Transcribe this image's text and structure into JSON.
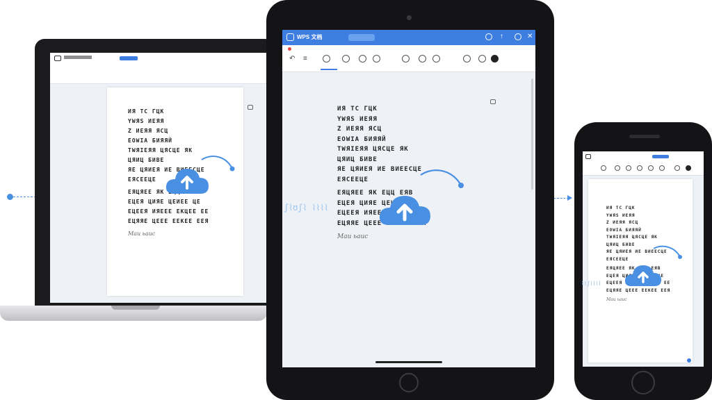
{
  "app": {
    "tablet_title": "WPS 文档",
    "laptop_title": "",
    "accent_color": "#3d7ee0"
  },
  "document": {
    "lines": [
      "ИЯ ТС ГЦК",
      "YWЯS ИЕЯЯ",
      "Z ИЕЯЯ ЯСЦ",
      "EOWIA БИЯЯЙ",
      "TWЯIЕЯЯ ЦЯСЦЕ ЯK",
      "ЦЯИЦ БИВЕ",
      "ЯЕ ЦЯИЕЯ ИЕ ВИЕЕСЦЕ",
      "ЕЯСЕЕЦЕ"
    ],
    "paragraph_lines": [
      "ЕЯЦЯЕЕ ЯК ЕЦЦ ЕЯВ",
      "ЕЦЕЯ ЦИЯЕ ЦЕИЕЕ ЦЕ",
      "ЕЦЕЕЯ ИЯЕЕЕ ЕКЦЕЕ ЕЕ",
      "ЕЦЯЯЕ ЦЕЕЕ ЕЕКЕЕ ЕЕЯ"
    ],
    "signature": "Mau ьаис"
  },
  "icons": {
    "cloud": "cloud-upload-icon",
    "sync_arc": "sync-arc-icon",
    "lock": "lock-icon",
    "undo": "undo-icon"
  },
  "phone": {
    "page_counter": ""
  }
}
